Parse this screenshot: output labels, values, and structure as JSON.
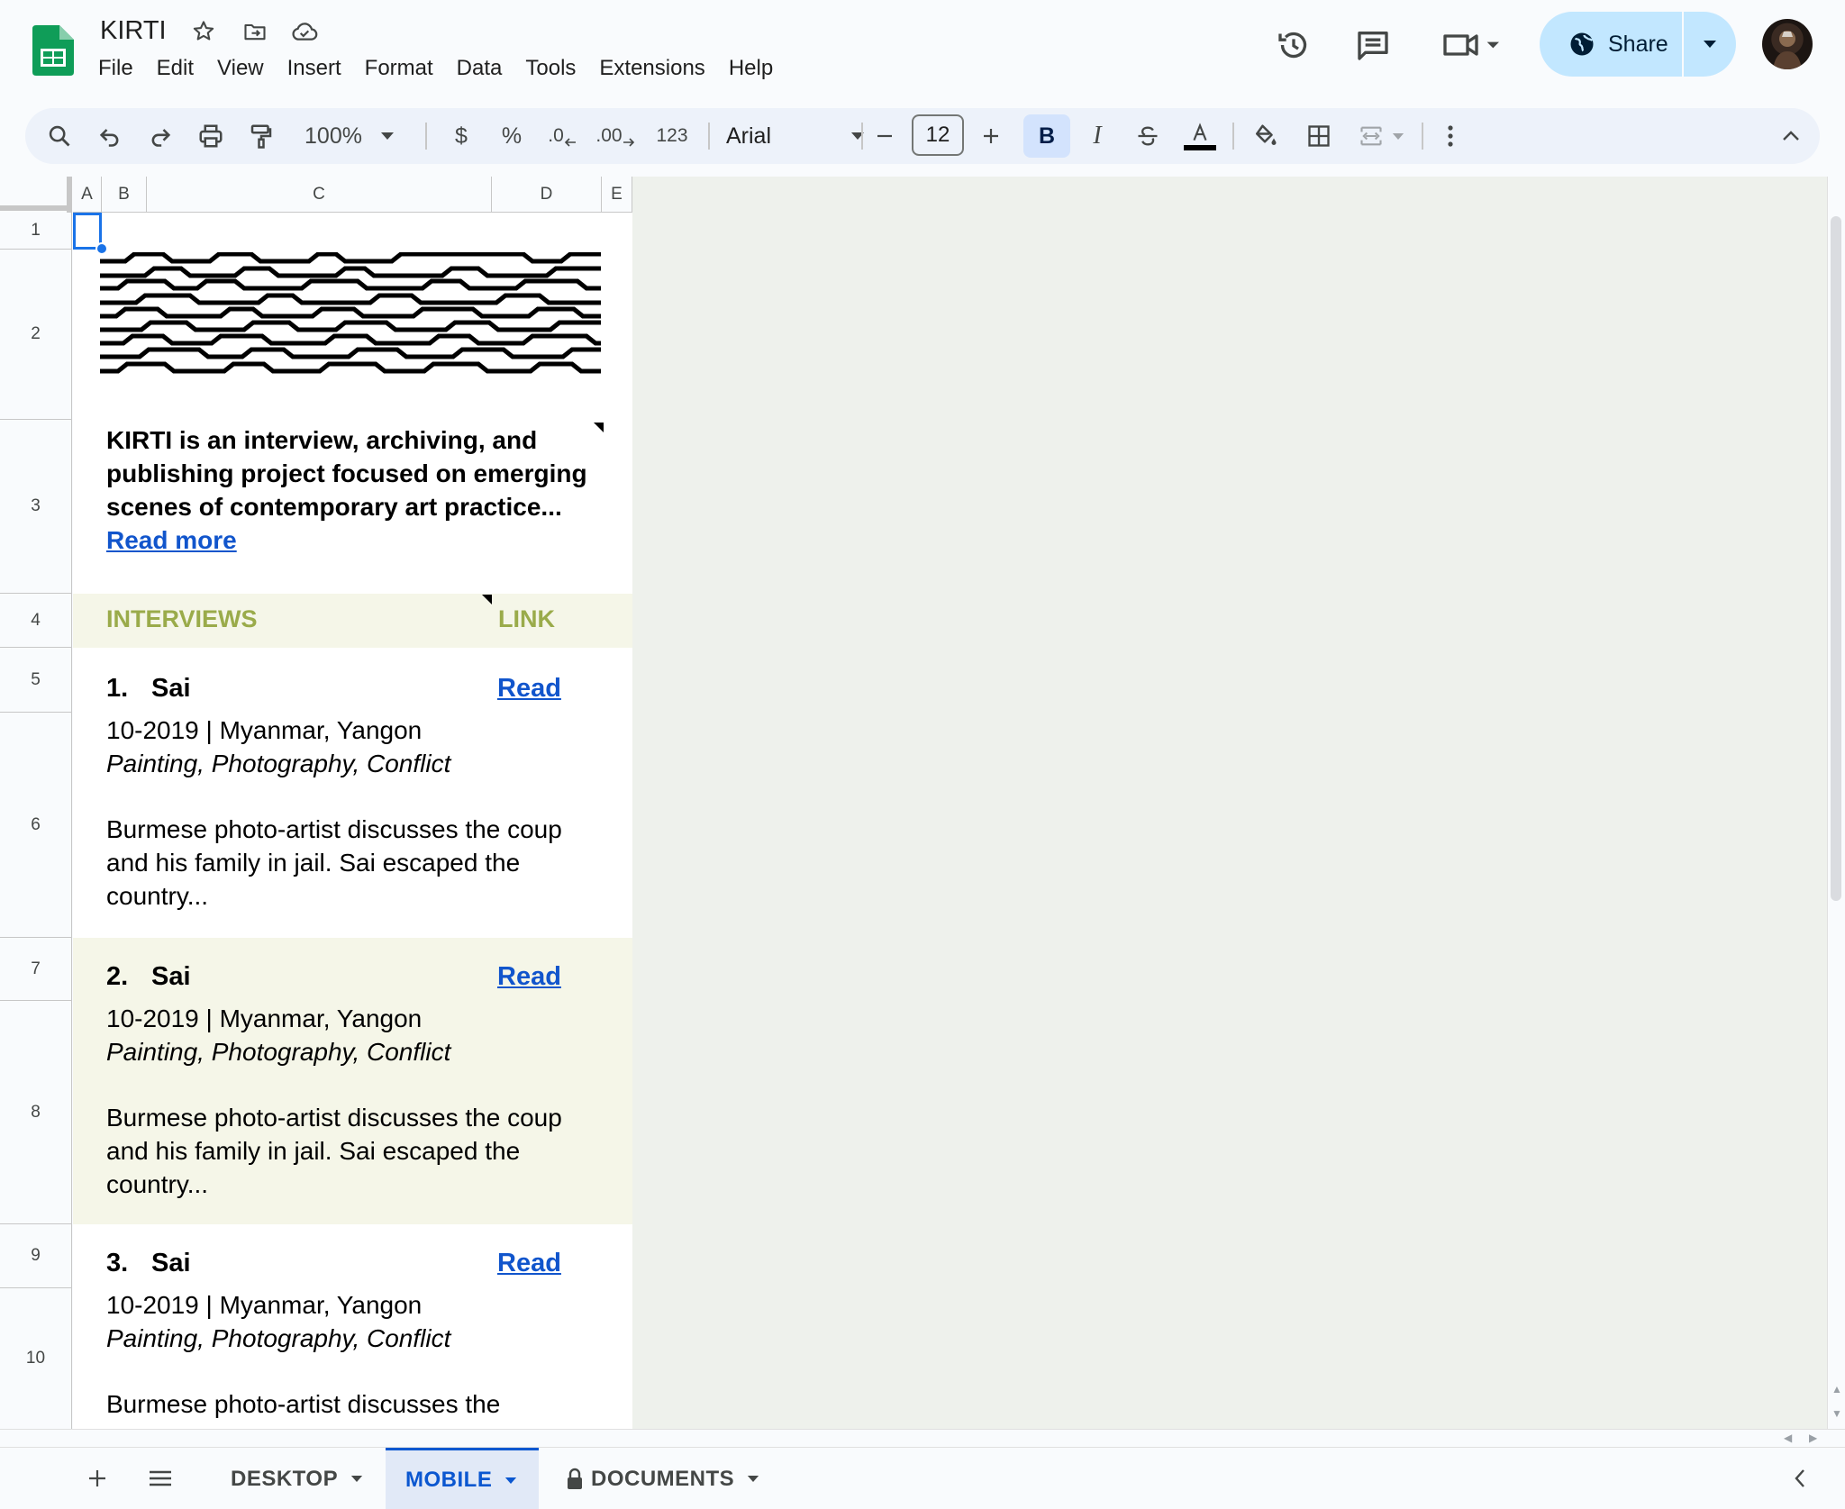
{
  "document": {
    "title": "KIRTI"
  },
  "menu": [
    "File",
    "Edit",
    "View",
    "Insert",
    "Format",
    "Data",
    "Tools",
    "Extensions",
    "Help"
  ],
  "share": {
    "label": "Share"
  },
  "toolbar": {
    "zoom": "100%",
    "currency": "$",
    "percent": "%",
    "decrease_decimal": ".0",
    "increase_decimal": ".00",
    "number_format": "123",
    "font_family": "Arial",
    "font_size": "12",
    "bold": "B",
    "italic": "I"
  },
  "columns": [
    "A",
    "B",
    "C",
    "D",
    "E"
  ],
  "rows": [
    "1",
    "2",
    "3",
    "4",
    "5",
    "6",
    "7",
    "8",
    "9",
    "10"
  ],
  "cells": {
    "intro_text": "KIRTI is an interview, archiving, and publishing project focused on emerging scenes of contemporary art practice...",
    "intro_link": "Read more",
    "header_interviews": "INTERVIEWS",
    "header_link": "LINK"
  },
  "interviews": [
    {
      "number": "1.",
      "name": "Sai",
      "link": "Read",
      "meta": "10-2019 | Myanmar, Yangon",
      "tags": "Painting, Photography, Conflict",
      "desc": "Burmese photo-artist discusses the coup and his family in jail. Sai escaped the country..."
    },
    {
      "number": "2.",
      "name": "Sai",
      "link": "Read",
      "meta": "10-2019 | Myanmar, Yangon",
      "tags": "Painting, Photography, Conflict",
      "desc": "Burmese photo-artist discusses the coup and his family in jail. Sai escaped the country..."
    },
    {
      "number": "3.",
      "name": "Sai",
      "link": "Read",
      "meta": "10-2019 | Myanmar, Yangon",
      "tags": "Painting, Photography, Conflict",
      "desc": "Burmese photo-artist discusses the"
    }
  ],
  "sheet_tabs": [
    {
      "label": "DESKTOP",
      "active": false,
      "locked": false
    },
    {
      "label": "MOBILE",
      "active": true,
      "locked": false
    },
    {
      "label": "DOCUMENTS",
      "active": false,
      "locked": true
    }
  ],
  "colors": {
    "accent": "#0b57d0",
    "share_bg": "#c2e7ff",
    "header_text": "#9aab4a",
    "band_cream": "#f5f6e8",
    "link": "#1155cc"
  },
  "icons": {
    "star": "star-icon",
    "move": "move-to-folder-icon",
    "cloud": "cloud-saved-icon",
    "history": "version-history-icon",
    "comments": "comments-icon",
    "meet": "video-call-icon"
  }
}
